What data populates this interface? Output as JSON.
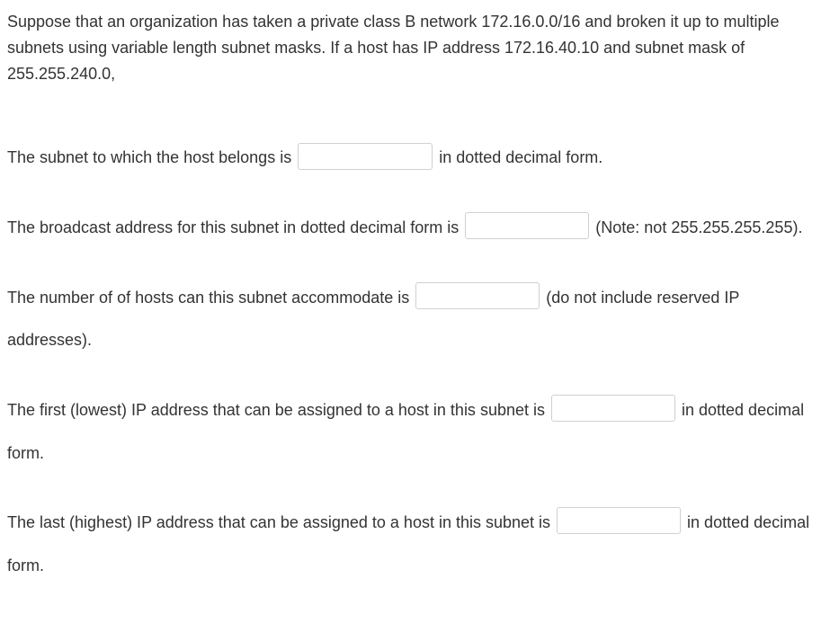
{
  "intro": "Suppose that an organization has taken a  private class B network 172.16.0.0/16 and broken it up to multiple subnets using variable length subnet masks.  If a host has IP address 172.16.40.10 and subnet mask of 255.255.240.0,",
  "q1": {
    "pre": "The subnet to which the host belongs is ",
    "post": " in dotted decimal form.",
    "value": ""
  },
  "q2": {
    "pre": "The broadcast address for this subnet in dotted decimal form is ",
    "post": " (Note: not 255.255.255.255).",
    "value": ""
  },
  "q3": {
    "pre": "The number of of hosts can this subnet accommodate is ",
    "post": " (do not include reserved IP addresses).",
    "value": ""
  },
  "q4": {
    "pre": "The first (lowest) IP address  that can be assigned to a host in this subnet is ",
    "post": " in dotted decimal form.",
    "value": ""
  },
  "q5": {
    "pre": "The last (highest) IP address  that can be assigned to a host in this subnet is ",
    "post": " in dotted decimal form.",
    "value": ""
  }
}
